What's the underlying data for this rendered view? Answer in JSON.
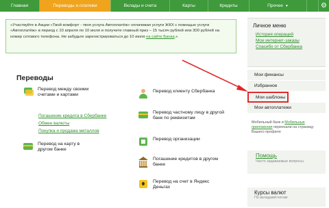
{
  "nav": {
    "tabs": [
      {
        "label": "Главная"
      },
      {
        "label": "Переводы и платежи"
      },
      {
        "label": "Вклады и счета"
      },
      {
        "label": "Карты"
      },
      {
        "label": "Кредиты"
      },
      {
        "label": "Прочее"
      }
    ]
  },
  "promo": {
    "text": "«Участвуйте в Акции «Твой комфорт - твоя услуга Автоплатёж» оплачивая услуги ЖКХ с помощью услуги «Автоплатёж» в период с 10 апреля по 10 июля и получите главный приз – 15 тысяч рублей или 300 рублей на номер сотового телефона. Не забудьте зарегистрироваться до 10 июля",
    "link": "на сайте Банка",
    "tail": ".»"
  },
  "transfers": {
    "heading": "Переводы",
    "own_accounts": "Перевод между своими счетами и картами",
    "sublinks": [
      "Погашение кредита в Сбербанке",
      "Обмен валюты",
      "Покупка и продажа металлов"
    ],
    "to_card": "Перевод на карту в другом банке",
    "to_client": "Перевод клиенту Сбербанка",
    "to_person": "Перевод частному лицу в другой банк по реквизитам",
    "to_org": "Перевод организации",
    "loan_other": "Погашение кредитов в другом банке",
    "yandex": "Перевод на счет в Яндекс Деньгах"
  },
  "sidebar": {
    "title": "Личное меню",
    "links": [
      "История операций",
      "Мои интернет-заказы",
      "Спасибо от Сбербанка"
    ],
    "items": [
      "Мои финансы",
      "Избранное",
      "Мои шаблоны",
      "Мои автоплатежи"
    ],
    "mobile": {
      "pre": "Мобильный банк и",
      "link": "Мобильные приложения",
      "post": "переехали на страницу Вашего профиля"
    },
    "help": {
      "title": "Помощь",
      "sub": "Часто задаваемые вопросы"
    },
    "rates": {
      "title": "Курсы валют",
      "sub": "По вкладам/счетам"
    }
  },
  "colors": {
    "nav_green": "#3e9a3a",
    "active_tab": "#f0a31c",
    "link_green": "#2f8f2a",
    "highlight_red": "#e0282a"
  }
}
